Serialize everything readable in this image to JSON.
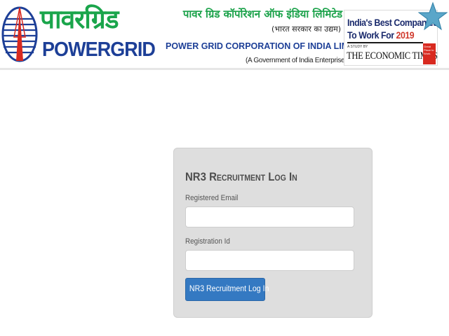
{
  "header": {
    "logo_hindi": "पावरग्रिड",
    "logo_english": "POWERGRID",
    "corp_name_hindi": "पावर ग्रिड कॉर्पोरेशन ऑफ इंडिया लिमिटेड",
    "govt_tag_hindi": "(भारत सरकार का उद्यम)",
    "corp_name_english": "POWER GRID CORPORATION OF INDIA LIMITED",
    "govt_tag_english": "(A Government of India Enterprise)"
  },
  "award": {
    "title_line1": "India's Best Companies",
    "title_line2_prefix": "To Work For ",
    "year": "2019",
    "study_note": "A STUDY BY",
    "publisher": "THE ECONOMIC TIMES",
    "badge_text": "Great Place to Work."
  },
  "login": {
    "title": "NR3 Recruitment Log In",
    "email_label": "Registered Email",
    "email_value": "",
    "regid_label": "Registration Id",
    "regid_value": "",
    "button_label": "NR3 Recruitment Log In"
  },
  "colors": {
    "brand_green": "#1aa54b",
    "brand_blue": "#1d3f97",
    "button_blue": "#3479c2",
    "panel_grey": "#dedede"
  },
  "icons": {
    "emblem": "powergrid-tower-emblem-icon",
    "star": "award-star-icon"
  }
}
